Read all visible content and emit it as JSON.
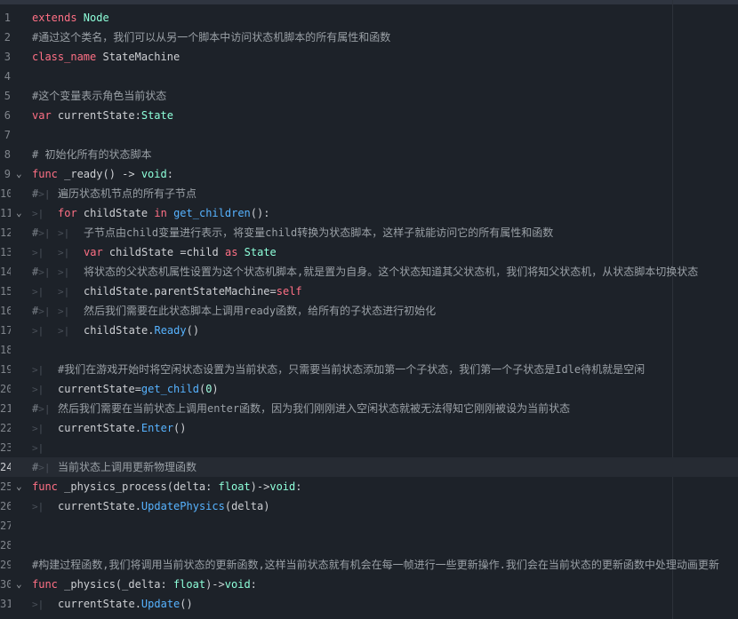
{
  "editor": {
    "current_line": 24,
    "lines": [
      {
        "n": "1",
        "segs": [
          {
            "t": "extends",
            "c": "kw"
          },
          {
            "t": " Node",
            "c": "ty"
          }
        ]
      },
      {
        "n": "2",
        "segs": [
          {
            "t": "#通过这个类名，我们可以从另一个脚本中访问状态机脚本的所有属性和函数",
            "c": "cm"
          }
        ]
      },
      {
        "n": "3",
        "segs": [
          {
            "t": "class_name",
            "c": "kw"
          },
          {
            "t": " StateMachine",
            "c": "tx"
          }
        ]
      },
      {
        "n": "4",
        "segs": []
      },
      {
        "n": "5",
        "segs": [
          {
            "t": "#这个变量表示角色当前状态",
            "c": "cm"
          }
        ]
      },
      {
        "n": "6",
        "segs": [
          {
            "t": "var",
            "c": "kw"
          },
          {
            "t": " currentState:",
            "c": "tx"
          },
          {
            "t": "State",
            "c": "ty"
          }
        ]
      },
      {
        "n": "7",
        "segs": []
      },
      {
        "n": "8",
        "segs": [
          {
            "t": "# 初始化所有的状态脚本",
            "c": "cm"
          }
        ]
      },
      {
        "n": "9",
        "fold": true,
        "segs": [
          {
            "t": "func",
            "c": "kw"
          },
          {
            "t": " _ready() -> ",
            "c": "tx"
          },
          {
            "t": "void",
            "c": "ty"
          },
          {
            "t": ":",
            "c": "tx"
          }
        ]
      },
      {
        "n": "10",
        "segs": [
          {
            "t": "#",
            "c": "ht"
          },
          {
            "t": "遍历状态机节点的所有子节点",
            "c": "cm"
          }
        ]
      },
      {
        "n": "11",
        "fold": true,
        "segs": [
          {
            "t": "",
            "c": "tab"
          },
          {
            "t": "for",
            "c": "kw"
          },
          {
            "t": " childState ",
            "c": "tx"
          },
          {
            "t": "in",
            "c": "kw"
          },
          {
            "t": " ",
            "c": "tx"
          },
          {
            "t": "get_children",
            "c": "fn"
          },
          {
            "t": "():",
            "c": "tx"
          }
        ]
      },
      {
        "n": "12",
        "segs": [
          {
            "t": "#",
            "c": "ht"
          },
          {
            "t": "",
            "c": "tab"
          },
          {
            "t": "子节点由child变量进行表示，将变量child转换为状态脚本，这样子就能访问它的所有属性和函数",
            "c": "cm"
          }
        ]
      },
      {
        "n": "13",
        "segs": [
          {
            "t": "",
            "c": "tab"
          },
          {
            "t": "",
            "c": "tab"
          },
          {
            "t": "var",
            "c": "kw"
          },
          {
            "t": " childState =child ",
            "c": "tx"
          },
          {
            "t": "as",
            "c": "kw"
          },
          {
            "t": " ",
            "c": "tx"
          },
          {
            "t": "State",
            "c": "ty"
          }
        ]
      },
      {
        "n": "14",
        "segs": [
          {
            "t": "#",
            "c": "ht"
          },
          {
            "t": "",
            "c": "tab"
          },
          {
            "t": "将状态的父状态机属性设置为这个状态机脚本,就是置为自身。这个状态知道其父状态机，我们将知父状态机，从状态脚本切换状态",
            "c": "cm"
          }
        ]
      },
      {
        "n": "15",
        "segs": [
          {
            "t": "",
            "c": "tab"
          },
          {
            "t": "",
            "c": "tab"
          },
          {
            "t": "childState.parentStateMachine=",
            "c": "tx"
          },
          {
            "t": "self",
            "c": "kw"
          }
        ]
      },
      {
        "n": "16",
        "segs": [
          {
            "t": "#",
            "c": "ht"
          },
          {
            "t": "",
            "c": "tab"
          },
          {
            "t": "然后我们需要在此状态脚本上调用ready函数，给所有的子状态进行初始化",
            "c": "cm"
          }
        ]
      },
      {
        "n": "17",
        "segs": [
          {
            "t": "",
            "c": "tab"
          },
          {
            "t": "",
            "c": "tab"
          },
          {
            "t": "childState.",
            "c": "tx"
          },
          {
            "t": "Ready",
            "c": "fn"
          },
          {
            "t": "()",
            "c": "tx"
          }
        ]
      },
      {
        "n": "18",
        "segs": []
      },
      {
        "n": "19",
        "segs": [
          {
            "t": "",
            "c": "tab"
          },
          {
            "t": "#我们在游戏开始时将空闲状态设置为当前状态，只需要当前状态添加第一个子状态，我们第一个子状态是Idle待机就是空闲",
            "c": "cm"
          }
        ]
      },
      {
        "n": "20",
        "segs": [
          {
            "t": "",
            "c": "tab"
          },
          {
            "t": "currentState=",
            "c": "tx"
          },
          {
            "t": "get_child",
            "c": "fn"
          },
          {
            "t": "(",
            "c": "tx"
          },
          {
            "t": "0",
            "c": "num"
          },
          {
            "t": ")",
            "c": "tx"
          }
        ]
      },
      {
        "n": "21",
        "segs": [
          {
            "t": "#",
            "c": "ht"
          },
          {
            "t": "然后我们需要在当前状态上调用enter函数，因为我们刚刚进入空闲状态就被无法得知它刚刚被设为当前状态",
            "c": "cm"
          }
        ]
      },
      {
        "n": "22",
        "segs": [
          {
            "t": "",
            "c": "tab"
          },
          {
            "t": "currentState.",
            "c": "tx"
          },
          {
            "t": "Enter",
            "c": "fn"
          },
          {
            "t": "()",
            "c": "tx"
          }
        ]
      },
      {
        "n": "23",
        "segs": [
          {
            "t": "",
            "c": "tab"
          }
        ]
      },
      {
        "n": "24",
        "segs": [
          {
            "t": "#",
            "c": "ht"
          },
          {
            "t": "当前状态上调用更新物理函数",
            "c": "cm"
          }
        ]
      },
      {
        "n": "25",
        "fold": true,
        "segs": [
          {
            "t": "func",
            "c": "kw"
          },
          {
            "t": " _physics_process(delta: ",
            "c": "tx"
          },
          {
            "t": "float",
            "c": "ty"
          },
          {
            "t": ")->",
            "c": "tx"
          },
          {
            "t": "void",
            "c": "ty"
          },
          {
            "t": ":",
            "c": "tx"
          }
        ]
      },
      {
        "n": "26",
        "segs": [
          {
            "t": "",
            "c": "tab"
          },
          {
            "t": "currentState.",
            "c": "tx"
          },
          {
            "t": "UpdatePhysics",
            "c": "fn"
          },
          {
            "t": "(delta)",
            "c": "tx"
          }
        ]
      },
      {
        "n": "27",
        "segs": []
      },
      {
        "n": "28",
        "segs": []
      },
      {
        "n": "29",
        "segs": [
          {
            "t": "#构建过程函数,我们将调用当前状态的更新函数,这样当前状态就有机会在每一帧进行一些更新操作.我们会在当前状态的更新函数中处理动画更新",
            "c": "cm"
          }
        ]
      },
      {
        "n": "30",
        "fold": true,
        "segs": [
          {
            "t": "func",
            "c": "kw"
          },
          {
            "t": " _physics(_delta: ",
            "c": "tx"
          },
          {
            "t": "float",
            "c": "ty"
          },
          {
            "t": ")->",
            "c": "tx"
          },
          {
            "t": "void",
            "c": "ty"
          },
          {
            "t": ":",
            "c": "tx"
          }
        ]
      },
      {
        "n": "31",
        "segs": [
          {
            "t": "",
            "c": "tab"
          },
          {
            "t": "currentState.",
            "c": "tx"
          },
          {
            "t": "Update",
            "c": "fn"
          },
          {
            "t": "()",
            "c": "tx"
          }
        ]
      }
    ]
  },
  "icons": {
    "fold": "chevron-down-icon",
    "tab": "tab-indent-icon"
  }
}
